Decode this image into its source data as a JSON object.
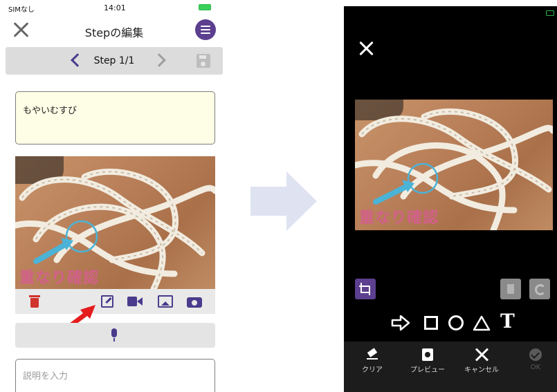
{
  "left_screen": {
    "status": {
      "carrier": "SIMなし",
      "time": "14:01"
    },
    "nav": {
      "title": "Stepの編集"
    },
    "step": {
      "label": "Step 1/1"
    },
    "title_field": {
      "value": "もやいむすび"
    },
    "photo": {
      "caption": "重なり確認"
    },
    "description_field": {
      "placeholder": "説明を入力"
    }
  },
  "right_screen": {
    "photo": {
      "caption": "重なり確認"
    },
    "shape_tools": {
      "text_tool": "T"
    },
    "bottom_bar": {
      "clear": "クリア",
      "preview": "プレビュー",
      "cancel": "キャンセル",
      "ok": "OK"
    }
  },
  "colors": {
    "accent": "#5c3f8f",
    "delete": "#d0342c",
    "title_bg": "#fefde6",
    "caption": "#d2608a",
    "marker_circle": "#4bb3d6",
    "pointer_arrow": "#e51c1c"
  }
}
